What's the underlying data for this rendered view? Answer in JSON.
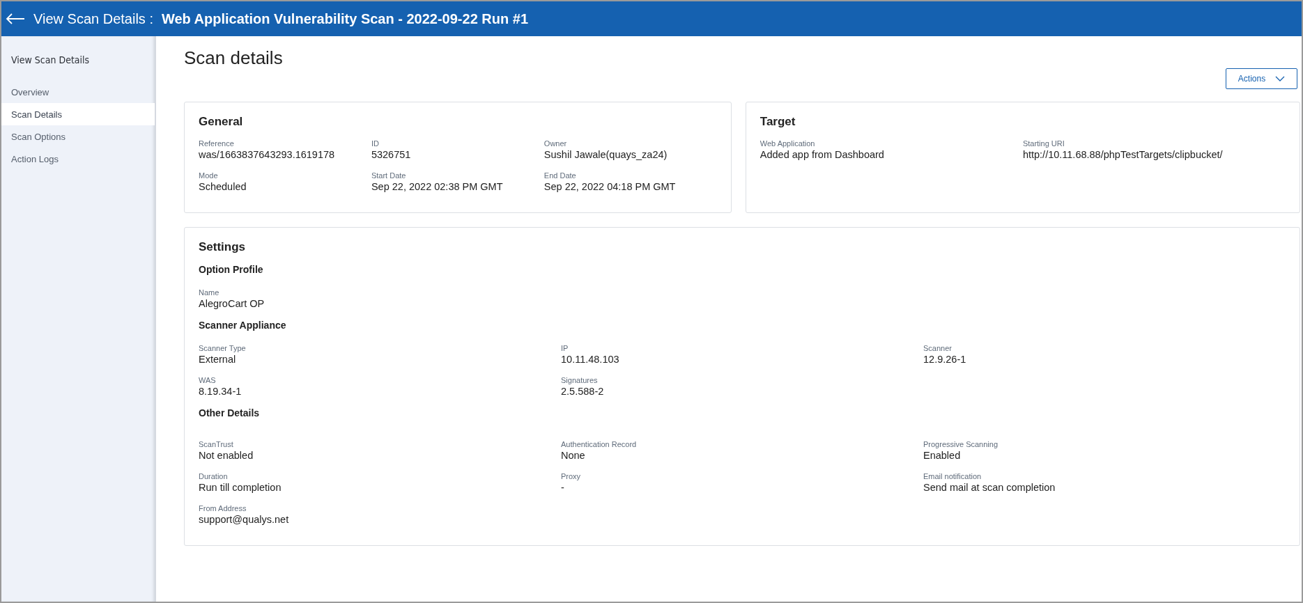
{
  "header": {
    "prefix": "View Scan Details :",
    "title": "Web Application Vulnerability Scan - 2022-09-22 Run #1"
  },
  "sidebar": {
    "heading": "View Scan Details",
    "items": [
      {
        "label": "Overview",
        "selected": false
      },
      {
        "label": "Scan Details",
        "selected": true
      },
      {
        "label": "Scan Options",
        "selected": false
      },
      {
        "label": "Action Logs",
        "selected": false
      }
    ]
  },
  "page_title": "Scan details",
  "actions_button": "Actions",
  "general": {
    "title": "General",
    "fields": [
      {
        "label": "Reference",
        "value": "was/1663837643293.1619178"
      },
      {
        "label": "ID",
        "value": "5326751"
      },
      {
        "label": "Owner",
        "value": "Sushil Jawale(quays_za24)"
      },
      {
        "label": "Mode",
        "value": "Scheduled"
      },
      {
        "label": "Start Date",
        "value": "Sep 22, 2022 02:38 PM GMT"
      },
      {
        "label": "End Date",
        "value": "Sep 22, 2022 04:18 PM GMT"
      }
    ]
  },
  "target": {
    "title": "Target",
    "fields": [
      {
        "label": "Web Application",
        "value": "Added app from Dashboard"
      },
      {
        "label": "Starting URI",
        "value": "http://10.11.68.88/phpTestTargets/clipbucket/"
      }
    ]
  },
  "settings": {
    "title": "Settings",
    "sections": [
      {
        "title": "Option Profile",
        "fields": [
          {
            "label": "Name",
            "value": "AlegroCart OP"
          }
        ]
      },
      {
        "title": "Scanner Appliance",
        "fields": [
          {
            "label": "Scanner Type",
            "value": "External"
          },
          {
            "label": "IP",
            "value": "10.11.48.103"
          },
          {
            "label": "Scanner",
            "value": "12.9.26-1"
          },
          {
            "label": "WAS",
            "value": "8.19.34-1"
          },
          {
            "label": "Signatures",
            "value": "2.5.588-2"
          }
        ]
      },
      {
        "title": "Other Details",
        "fields": [
          {
            "label": "ScanTrust",
            "value": "Not enabled"
          },
          {
            "label": "Authentication Record",
            "value": "None"
          },
          {
            "label": "Progressive Scanning",
            "value": "Enabled"
          },
          {
            "label": "Duration",
            "value": "Run till completion"
          },
          {
            "label": "Proxy",
            "value": "-"
          },
          {
            "label": "Email notification",
            "value": "Send mail at scan completion"
          },
          {
            "label": "From Address",
            "value": "support@qualys.net"
          }
        ]
      }
    ]
  }
}
